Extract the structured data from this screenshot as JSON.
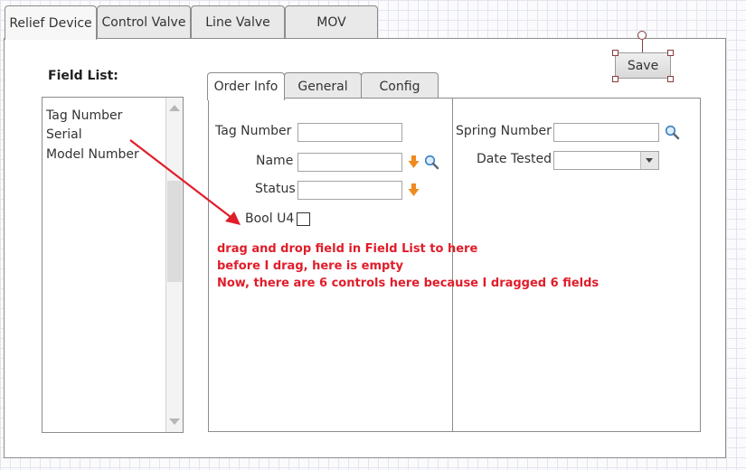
{
  "outer_tabs": [
    {
      "label": "Relief Device",
      "active": true
    },
    {
      "label": "Control Valve",
      "active": false
    },
    {
      "label": "Line Valve",
      "active": false
    },
    {
      "label": "MOV",
      "active": false
    }
  ],
  "save_button": {
    "label": "Save"
  },
  "field_list": {
    "label": "Field List:",
    "items": [
      "Tag Number",
      "Serial",
      "Model Number"
    ]
  },
  "inner_tabs": [
    {
      "label": "Order Info",
      "active": true
    },
    {
      "label": "General",
      "active": false
    },
    {
      "label": "Config",
      "active": false
    }
  ],
  "form_left": {
    "tag_number": {
      "label": "Tag Number",
      "value": ""
    },
    "name": {
      "label": "Name",
      "value": ""
    },
    "status": {
      "label": "Status",
      "value": ""
    },
    "bool_u4": {
      "label": "Bool U4",
      "checked": false
    }
  },
  "form_right": {
    "spring_number": {
      "label": "Spring Number",
      "value": ""
    },
    "date_tested": {
      "label": "Date Tested",
      "value": ""
    }
  },
  "annotation": {
    "line1": "drag and drop field in Field List to here",
    "line2": "before I drag, here is empty",
    "line3": "Now, there are 6 controls here because I dragged 6 fields",
    "color": "#e01d2a"
  },
  "icons": {
    "lookup": "magnifier-icon",
    "sort": "orange-down-arrow-icon"
  }
}
